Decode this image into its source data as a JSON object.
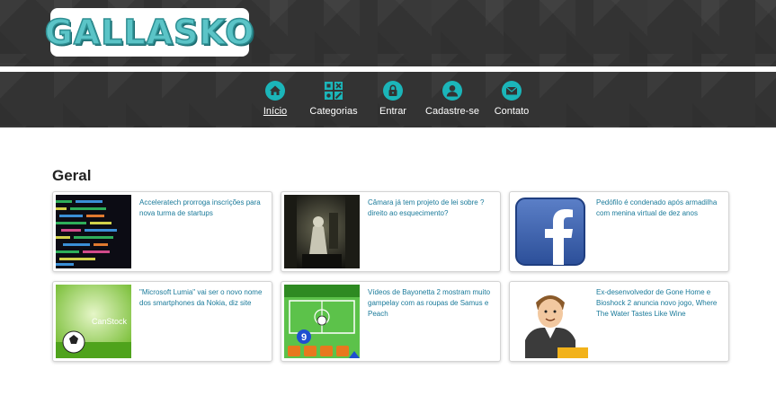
{
  "logo": {
    "text": "GALLASKO"
  },
  "nav": {
    "items": [
      {
        "label": "Início",
        "icon": "home-icon"
      },
      {
        "label": "Categorias",
        "icon": "categories-icon"
      },
      {
        "label": "Entrar",
        "icon": "lock-icon"
      },
      {
        "label": "Cadastre-se",
        "icon": "user-icon"
      },
      {
        "label": "Contato",
        "icon": "mail-icon"
      }
    ]
  },
  "colors": {
    "accent": "#1bb5b9",
    "header_bg": "#333333",
    "link": "#1a7a9a"
  },
  "section": {
    "title": "Geral"
  },
  "articles": [
    {
      "title": "Acceleratech prorroga inscrições para nova turma de startups"
    },
    {
      "title": "Câmara já tem projeto de lei sobre ?direito ao esquecimento?"
    },
    {
      "title": "Pedófilo é condenado após armadilha com menina virtual de dez anos"
    },
    {
      "title": "\"Microsoft Lumia\" vai ser o novo nome dos smartphones da Nokia, diz site",
      "watermark": "CanStock"
    },
    {
      "title": "Vídeos de Bayonetta 2 mostram muito gampelay com as roupas de Samus e Peach",
      "game_number": "9"
    },
    {
      "title": "Ex-desenvolvedor de Gone Home e Bioshock 2 anuncia novo jogo, Where The Water Tastes Like Wine"
    }
  ]
}
